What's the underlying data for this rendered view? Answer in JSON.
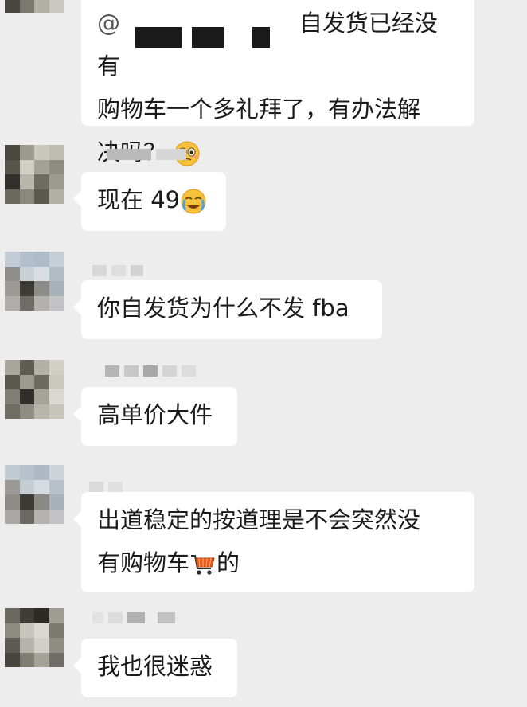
{
  "chat": {
    "messages": [
      {
        "mention": "@",
        "text_line1": "自发货已经没有",
        "text_line2": "购物车一个多礼拜了，有办法解",
        "text_line3": "决吗？",
        "emoji": "woozy-face-icon"
      },
      {
        "text": "现在 49",
        "emoji": "crying-face-icon"
      },
      {
        "text": "你自发货为什么不发 fba"
      },
      {
        "text": "高单价大件"
      },
      {
        "text_line1": "出道稳定的按道理是不会突然没",
        "text_line2_before": "有购物车",
        "text_line2_after": "的",
        "emoji": "shopping-cart-icon"
      },
      {
        "text": "我也很迷惑"
      }
    ]
  },
  "colors": {
    "background": "#ededed",
    "bubble": "#ffffff",
    "text": "#1b1b1b"
  }
}
